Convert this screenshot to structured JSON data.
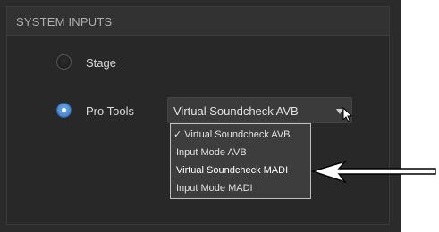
{
  "panel": {
    "title": "SYSTEM INPUTS"
  },
  "inputs": [
    {
      "label": "Stage",
      "selected": false
    },
    {
      "label": "Pro Tools",
      "selected": true
    }
  ],
  "dropdown": {
    "selected_value": "Virtual Soundcheck AVB",
    "options": [
      {
        "label": "✓ Virtual Soundcheck AVB",
        "checked": true
      },
      {
        "label": "Input Mode AVB",
        "checked": false
      },
      {
        "label": "Virtual Soundcheck MADI",
        "checked": false,
        "highlighted": true
      },
      {
        "label": "Input Mode MADI",
        "checked": false
      }
    ]
  },
  "colors": {
    "panel_bg": "#2b2b2b",
    "radio_active": "#4a8ad6",
    "callout_arrow": "#000000"
  },
  "icons": {
    "dropdown_arrow": "chevron-down-icon",
    "cursor": "mouse-pointer-icon",
    "callout": "arrow-left-icon"
  }
}
